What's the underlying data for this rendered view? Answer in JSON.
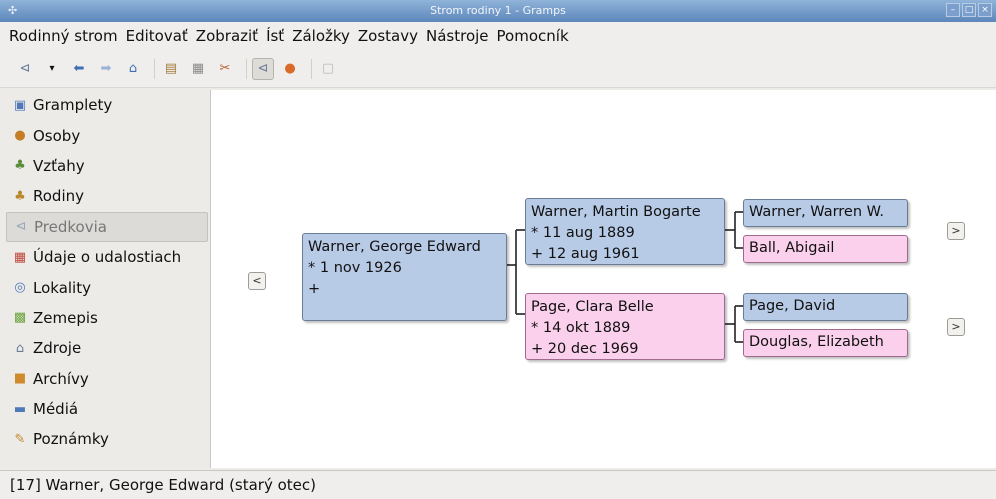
{
  "window": {
    "title": "Strom rodiny 1 - Gramps"
  },
  "menu": [
    {
      "label": "Rodinný strom"
    },
    {
      "label": "Editovať"
    },
    {
      "label": "Zobraziť"
    },
    {
      "label": "Ísť"
    },
    {
      "label": "Záložky"
    },
    {
      "label": "Zostavy"
    },
    {
      "label": "Nástroje"
    },
    {
      "label": "Pomocník"
    }
  ],
  "sidebar": {
    "items": [
      {
        "label": "Gramplety"
      },
      {
        "label": "Osoby"
      },
      {
        "label": "Vzťahy"
      },
      {
        "label": "Rodiny"
      },
      {
        "label": "Predkovia"
      },
      {
        "label": "Údaje o udalostiach"
      },
      {
        "label": "Lokality"
      },
      {
        "label": "Zemepis"
      },
      {
        "label": "Zdroje"
      },
      {
        "label": "Archívy"
      },
      {
        "label": "Médiá"
      },
      {
        "label": "Poznámky"
      }
    ],
    "selected": "Predkovia"
  },
  "tree": {
    "root": {
      "name": "Warner, George Edward",
      "birth": "* 1 nov 1926",
      "death": "+"
    },
    "father": {
      "name": "Warner, Martin Bogarte",
      "birth": "* 11 aug 1889",
      "death": "+ 12 aug 1961"
    },
    "mother": {
      "name": "Page, Clara Belle",
      "birth": "* 14 okt 1889",
      "death": "+ 20 dec 1969"
    },
    "paternal_grandfather": {
      "name": "Warner, Warren W."
    },
    "paternal_grandmother": {
      "name": "Ball, Abigail"
    },
    "maternal_grandfather": {
      "name": "Page, David"
    },
    "maternal_grandmother": {
      "name": "Douglas, Elizabeth"
    },
    "colors": {
      "male": "#b8cbe6",
      "female": "#fbd0ec"
    }
  },
  "nav_buttons": {
    "back": "<",
    "forward": ">"
  },
  "status": {
    "text": "[17] Warner, George Edward (starý otec)"
  }
}
